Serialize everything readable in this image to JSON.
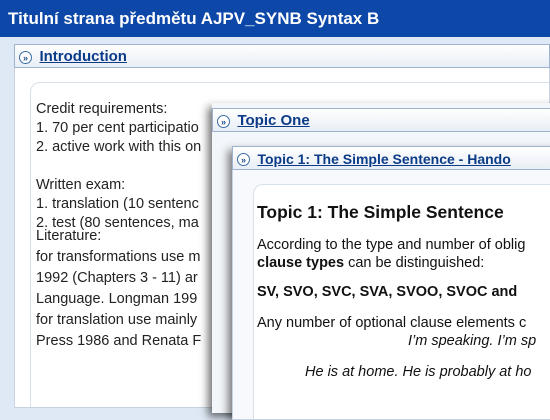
{
  "page_title": "Titulní strana předmětu AJPV_SYNB Syntax B",
  "intro": {
    "header": "Introduction",
    "lines": [
      "Credit requirements:",
      "1. 70 per cent participatio",
      "2. active work with this on",
      "",
      "Written exam:",
      "1. translation (10 sentenc",
      "2. test (80 sentences, ma",
      "Literature:",
      "for transformations use m",
      "1992 (Chapters 3 - 11) ar",
      "Language. Longman 199",
      "for translation use mainly",
      "Press 1986 and Renata F"
    ]
  },
  "topic_one": {
    "header": "Topic One"
  },
  "topic_window": {
    "header": "Topic 1: The Simple Sentence - Hando",
    "heading": "Topic 1: The Simple Sentence",
    "p1_text": "According to the type and number of oblig",
    "p1_bold": "clause types",
    "p1_rest": " can be distinguished:",
    "clause_list": "SV, SVO, SVC, SVA, SVOO, SVOC and",
    "p2_text": "Any number of optional clause elements c",
    "p2_italic": "I’m speaking. I’m sp",
    "example": "He is at home. He is probably at ho"
  },
  "icons": {
    "expand": "double-chevron-right-icon"
  },
  "colors": {
    "title_bar": "#0d47a8",
    "link": "#0b3b87",
    "background": "#dfe9f5"
  }
}
